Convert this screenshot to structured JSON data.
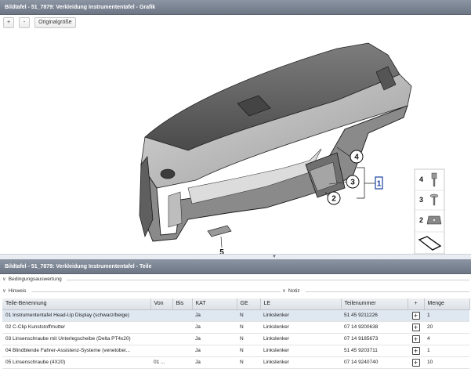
{
  "graphic_panel": {
    "title": "Bildtafel - 51_7879: Verkleidung Instrumententafel - Grafik",
    "zoom_in_label": "+",
    "zoom_out_label": "-",
    "original_size_label": "Originalgröße",
    "callouts": [
      "1",
      "2",
      "3",
      "4",
      "5"
    ],
    "thumbnails": [
      "4",
      "3",
      "2"
    ]
  },
  "parts_panel": {
    "title": "Bildtafel - 51_7879: Verkleidung Instrumententafel - Teile",
    "condition_label": "Bedingungsauswertung",
    "hint_label": "Hinweis",
    "note_label": "Notiz",
    "columns": [
      "Teile-Benennung",
      "Von",
      "Bis",
      "KAT",
      "GE",
      "LE",
      "Teilenummer",
      "+",
      "Menge"
    ],
    "rows": [
      {
        "name": "01 Instrumententafel Head-Up Display (schwarz/beige)",
        "von": "",
        "bis": "",
        "kat": "Ja",
        "ge": "N",
        "le": "Linkslenker",
        "part_no": "51 45 9211226",
        "qty": "1"
      },
      {
        "name": "02 C-Clip Kunststoffmutter",
        "von": "",
        "bis": "",
        "kat": "Ja",
        "ge": "N",
        "le": "Linkslenker",
        "part_no": "07 14 9200638",
        "qty": "20"
      },
      {
        "name": "03 Linsenschraube mit Unterlegscheibe (Delta PT4x20)",
        "von": "",
        "bis": "",
        "kat": "Ja",
        "ge": "N",
        "le": "Linkslenker",
        "part_no": "07 14 9185673",
        "qty": "4"
      },
      {
        "name": "04 Blindblende Fahrer-Assistenz-Systeme (venetobei...",
        "von": "",
        "bis": "",
        "kat": "Ja",
        "ge": "N",
        "le": "Linkslenker",
        "part_no": "51 45 9203711",
        "qty": "1"
      },
      {
        "name": "05 Linsenschraube (4X20)",
        "von": "01 ...",
        "bis": "",
        "kat": "Ja",
        "ge": "N",
        "le": "Linkslenker",
        "part_no": "07 14 9240740",
        "qty": "10"
      }
    ]
  },
  "colors": {
    "header_bg": "#7a8390",
    "selected_row": "#dfe7f1",
    "callout_highlight": "#1c3f9c"
  }
}
